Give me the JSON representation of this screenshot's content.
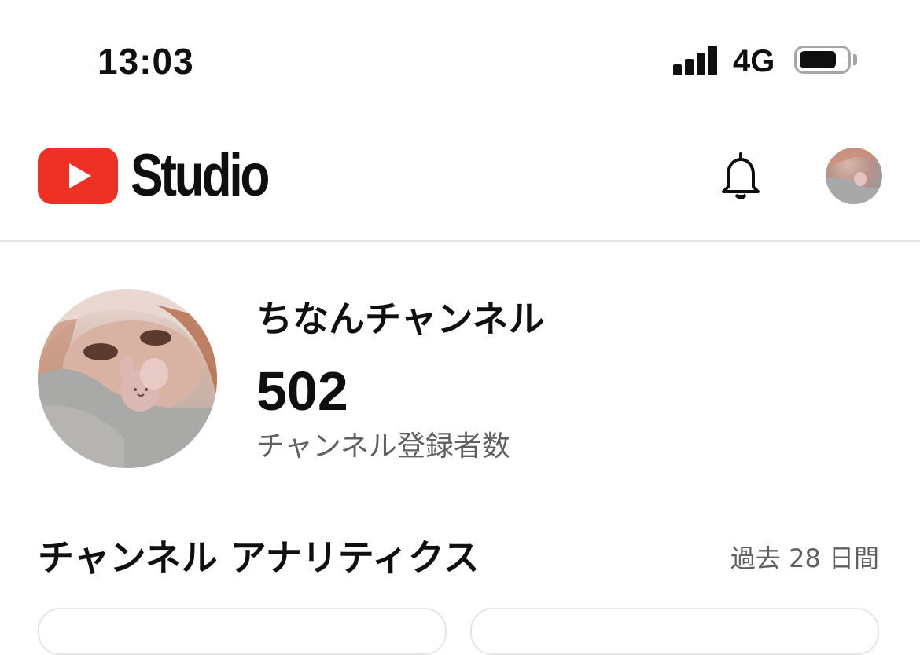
{
  "status_bar": {
    "time": "13:03",
    "network": "4G",
    "icons": [
      "signal-icon",
      "battery-icon"
    ]
  },
  "header": {
    "logo_text": "Studio",
    "icons": [
      "youtube-play-icon",
      "bell-icon",
      "avatar"
    ]
  },
  "channel": {
    "name": "ちなんチャンネル",
    "subscriber_count": "502",
    "subscriber_label": "チャンネル登録者数"
  },
  "analytics": {
    "title": "チャンネル アナリティクス",
    "period": "過去 28 日間"
  },
  "colors": {
    "brand_red": "#ee3124",
    "text_primary": "#0f0f0f",
    "text_secondary": "#606060",
    "divider": "#e5e5e5"
  }
}
